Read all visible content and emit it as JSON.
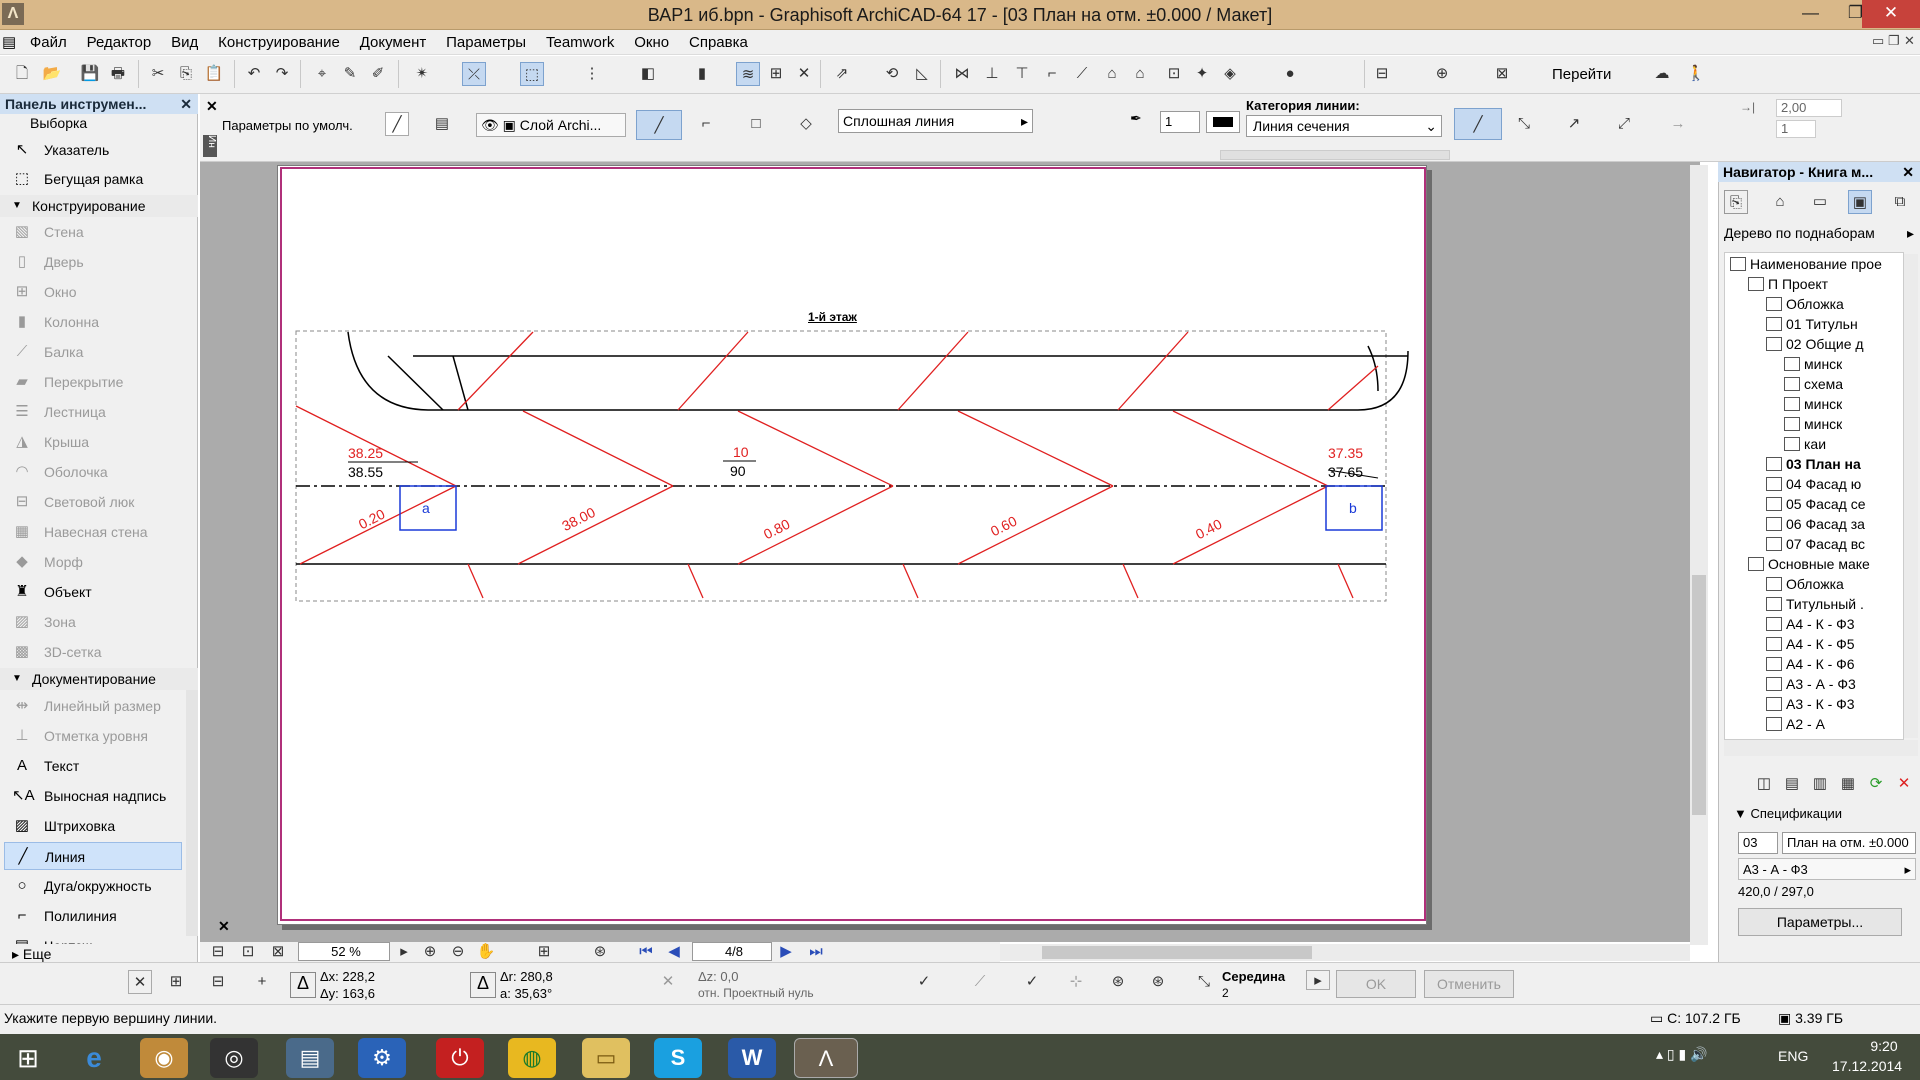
{
  "window": {
    "title": "ВАР1 иб.bpn - Graphisoft ArchiCAD-64 17 - [03 План на отм. ±0.000 / Макет]",
    "minimize": "—",
    "maximize": "❐",
    "close": "✕"
  },
  "menu": [
    "Файл",
    "Редактор",
    "Вид",
    "Конструирование",
    "Документ",
    "Параметры",
    "Teamwork",
    "Окно",
    "Справка"
  ],
  "toolbar": {
    "goto_label": "Перейти"
  },
  "toolbox": {
    "title": "Панель инструмен...",
    "selection_label": "Выборка",
    "pointer": "Указатель",
    "marquee": "Бегущая рамка",
    "design_section": "Конструирование",
    "design_items": [
      "Стена",
      "Дверь",
      "Окно",
      "Колонна",
      "Балка",
      "Перекрытие",
      "Лестница",
      "Крыша",
      "Оболочка",
      "Световой люк",
      "Навесная стена",
      "Морф",
      "Объект",
      "Зона",
      "3D-сетка"
    ],
    "doc_section": "Документирование",
    "doc_items": [
      "Линейный размер",
      "Отметка уровня",
      "Текст",
      "Выносная надпись",
      "Штриховка",
      "Линия",
      "Дуга/окружность",
      "Полилиния",
      "Чертеж"
    ],
    "more": "Еще"
  },
  "infobox": {
    "defaults": "Параметры по умолч.",
    "layer": "Слой Archi...",
    "linetype": "Сплошная линия",
    "pen": "1",
    "line_category_label": "Категория линии:",
    "line_category": "Линия сечения",
    "value_a": "2,00",
    "value_b": "1"
  },
  "drawing": {
    "title": "1-й этаж",
    "labels": [
      "38.25",
      "38.55",
      "10",
      "90",
      "37.35",
      "37.65",
      "0.20",
      "38.00",
      "0.80",
      "0.60",
      "0.40",
      "a",
      "b"
    ]
  },
  "navigator": {
    "title": "Навигатор - Книга м...",
    "view_mode": "Дерево по поднаборам",
    "tree": [
      "Наименование прое",
      "П Проект",
      "Обложка",
      "01 Титульн",
      "02 Общие д",
      "минск",
      "схема",
      "минск",
      "минск",
      "каи",
      "03 План на",
      "04 Фасад ю",
      "05 Фасад се",
      "06 Фасад за",
      "07 Фасад вс",
      "Основные маке",
      "Обложка",
      "Титульный .",
      "А4 - К - Ф3",
      "А4 - К - Ф5",
      "А4 - К - Ф6",
      "А3 - А - Ф3",
      "А3 - К - Ф3",
      "А2 - А"
    ],
    "specs_label": "Спецификации",
    "spec_number": "03",
    "spec_name": "План на отм. ±0.000",
    "spec_master": "А3 - А - Ф3",
    "spec_size": "420,0 / 297,0",
    "params_button": "Параметры..."
  },
  "viewbar": {
    "zoom": "52 %",
    "page": "4/8"
  },
  "coords": {
    "dx": "Δх: 228,2",
    "dy": "Δу: 163,6",
    "dr": "Δr: 280,8",
    "angle": "a: 35,63°",
    "dz": "Δz: 0,0",
    "ref": "отн. Проектный нуль",
    "snap": "Середина",
    "snap_n": "2",
    "ok": "OK",
    "cancel": "Отменить"
  },
  "status": {
    "hint": "Укажите первую вершину линии.",
    "disk": "С: 107.2 ГБ",
    "mem": "3.39 ГБ"
  },
  "tray": {
    "lang": "ENG",
    "time": "9:20",
    "date": "17.12.2014"
  }
}
